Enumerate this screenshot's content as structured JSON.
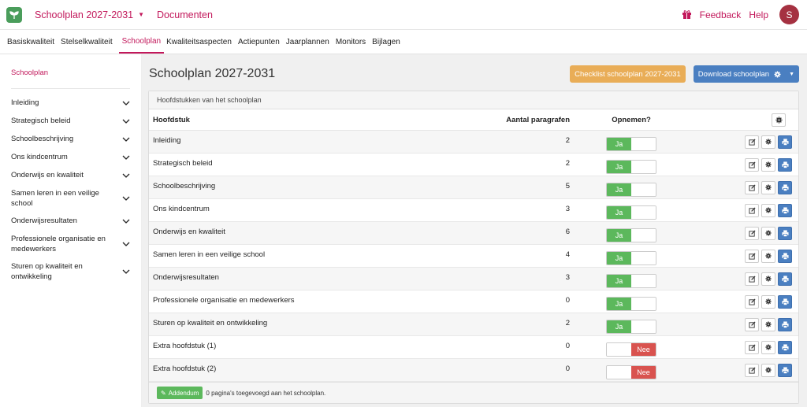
{
  "topbar": {
    "plan_label": "Schoolplan 2027-2031",
    "documents_label": "Documenten",
    "feedback_label": "Feedback",
    "help_label": "Help",
    "avatar_initial": "S"
  },
  "tabs": [
    "Basiskwaliteit",
    "Stelselkwaliteit",
    "Schoolplan",
    "Kwaliteitsaspecten",
    "Actiepunten",
    "Jaarplannen",
    "Monitors",
    "Bijlagen"
  ],
  "active_tab": "Schoolplan",
  "sidebar": {
    "title": "Schoolplan",
    "items": [
      {
        "label": "Inleiding"
      },
      {
        "label": "Strategisch beleid"
      },
      {
        "label": "Schoolbeschrijving"
      },
      {
        "label": "Ons kindcentrum"
      },
      {
        "label": "Onderwijs en kwaliteit"
      },
      {
        "label": "Samen leren in een veilige school"
      },
      {
        "label": "Onderwijsresultaten"
      },
      {
        "label": "Professionele organisatie en medewerkers"
      },
      {
        "label": "Sturen op kwaliteit en ontwikkeling"
      }
    ]
  },
  "main": {
    "title": "Schoolplan 2027-2031",
    "checklist_label": "Checklist schoolplan 2027-2031",
    "download_label": "Download schoolplan",
    "panel_title": "Hoofdstukken van het schoolplan",
    "columns": {
      "chapter": "Hoofdstuk",
      "count": "Aantal paragrafen",
      "include": "Opnemen?"
    },
    "rows": [
      {
        "name": "Inleiding",
        "count": "2",
        "include": "Ja"
      },
      {
        "name": "Strategisch beleid",
        "count": "2",
        "include": "Ja"
      },
      {
        "name": "Schoolbeschrijving",
        "count": "5",
        "include": "Ja"
      },
      {
        "name": "Ons kindcentrum",
        "count": "3",
        "include": "Ja"
      },
      {
        "name": "Onderwijs en kwaliteit",
        "count": "6",
        "include": "Ja"
      },
      {
        "name": "Samen leren in een veilige school",
        "count": "4",
        "include": "Ja"
      },
      {
        "name": "Onderwijsresultaten",
        "count": "3",
        "include": "Ja"
      },
      {
        "name": "Professionele organisatie en medewerkers",
        "count": "0",
        "include": "Ja"
      },
      {
        "name": "Sturen op kwaliteit en ontwikkeling",
        "count": "2",
        "include": "Ja"
      },
      {
        "name": "Extra hoofdstuk (1)",
        "count": "0",
        "include": "Nee"
      },
      {
        "name": "Extra hoofdstuk (2)",
        "count": "0",
        "include": "Nee"
      }
    ],
    "addendum_label": "Addendum",
    "addendum_note": "0 pagina's toegevoegd aan het schoolplan."
  },
  "colors": {
    "brand": "#c2185b",
    "green": "#5cb85c",
    "red": "#d9534f",
    "blue": "#4a7fc1",
    "orange": "#e9ad57"
  }
}
